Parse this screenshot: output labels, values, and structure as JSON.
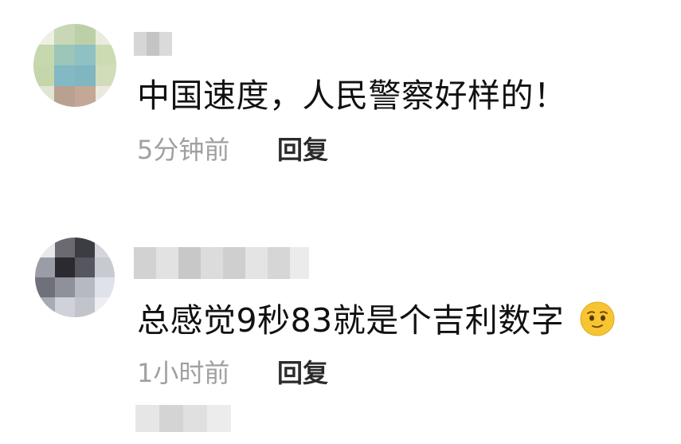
{
  "comments": [
    {
      "text": "中国速度，人民警察好样的！",
      "time": "5分钟前",
      "reply_label": "回复"
    },
    {
      "text": "总感觉9秒83就是个吉利数字",
      "emoji": "smirk-face-emoji",
      "time": "1小时前",
      "reply_label": "回复"
    }
  ],
  "colors": {
    "text": "#111111",
    "meta": "#a0a0a0",
    "reply": "#2b2b2b",
    "emoji_face": "#f7c531"
  }
}
